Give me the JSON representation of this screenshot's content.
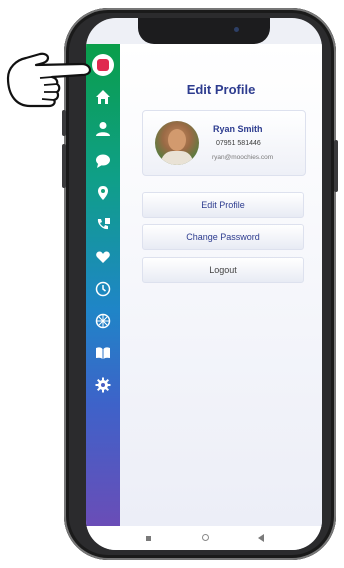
{
  "page": {
    "title": "Edit Profile"
  },
  "profile": {
    "name": "Ryan Smith",
    "phone": "07951 581446",
    "email": "ryan@moochies.com"
  },
  "actions": {
    "edit_profile": "Edit Profile",
    "change_password": "Change Password",
    "logout": "Logout"
  },
  "sidebar": {
    "icons": [
      "logo",
      "home-icon",
      "user-icon",
      "chat-icon",
      "location-icon",
      "phone-book-icon",
      "heart-icon",
      "clock-icon",
      "compass-icon",
      "book-icon",
      "gear-icon"
    ]
  },
  "colors": {
    "accent": "#2d3c8f",
    "logo": "#e0294f",
    "sidebar_top": "#0a9e4a",
    "sidebar_bottom": "#6a4db7"
  }
}
